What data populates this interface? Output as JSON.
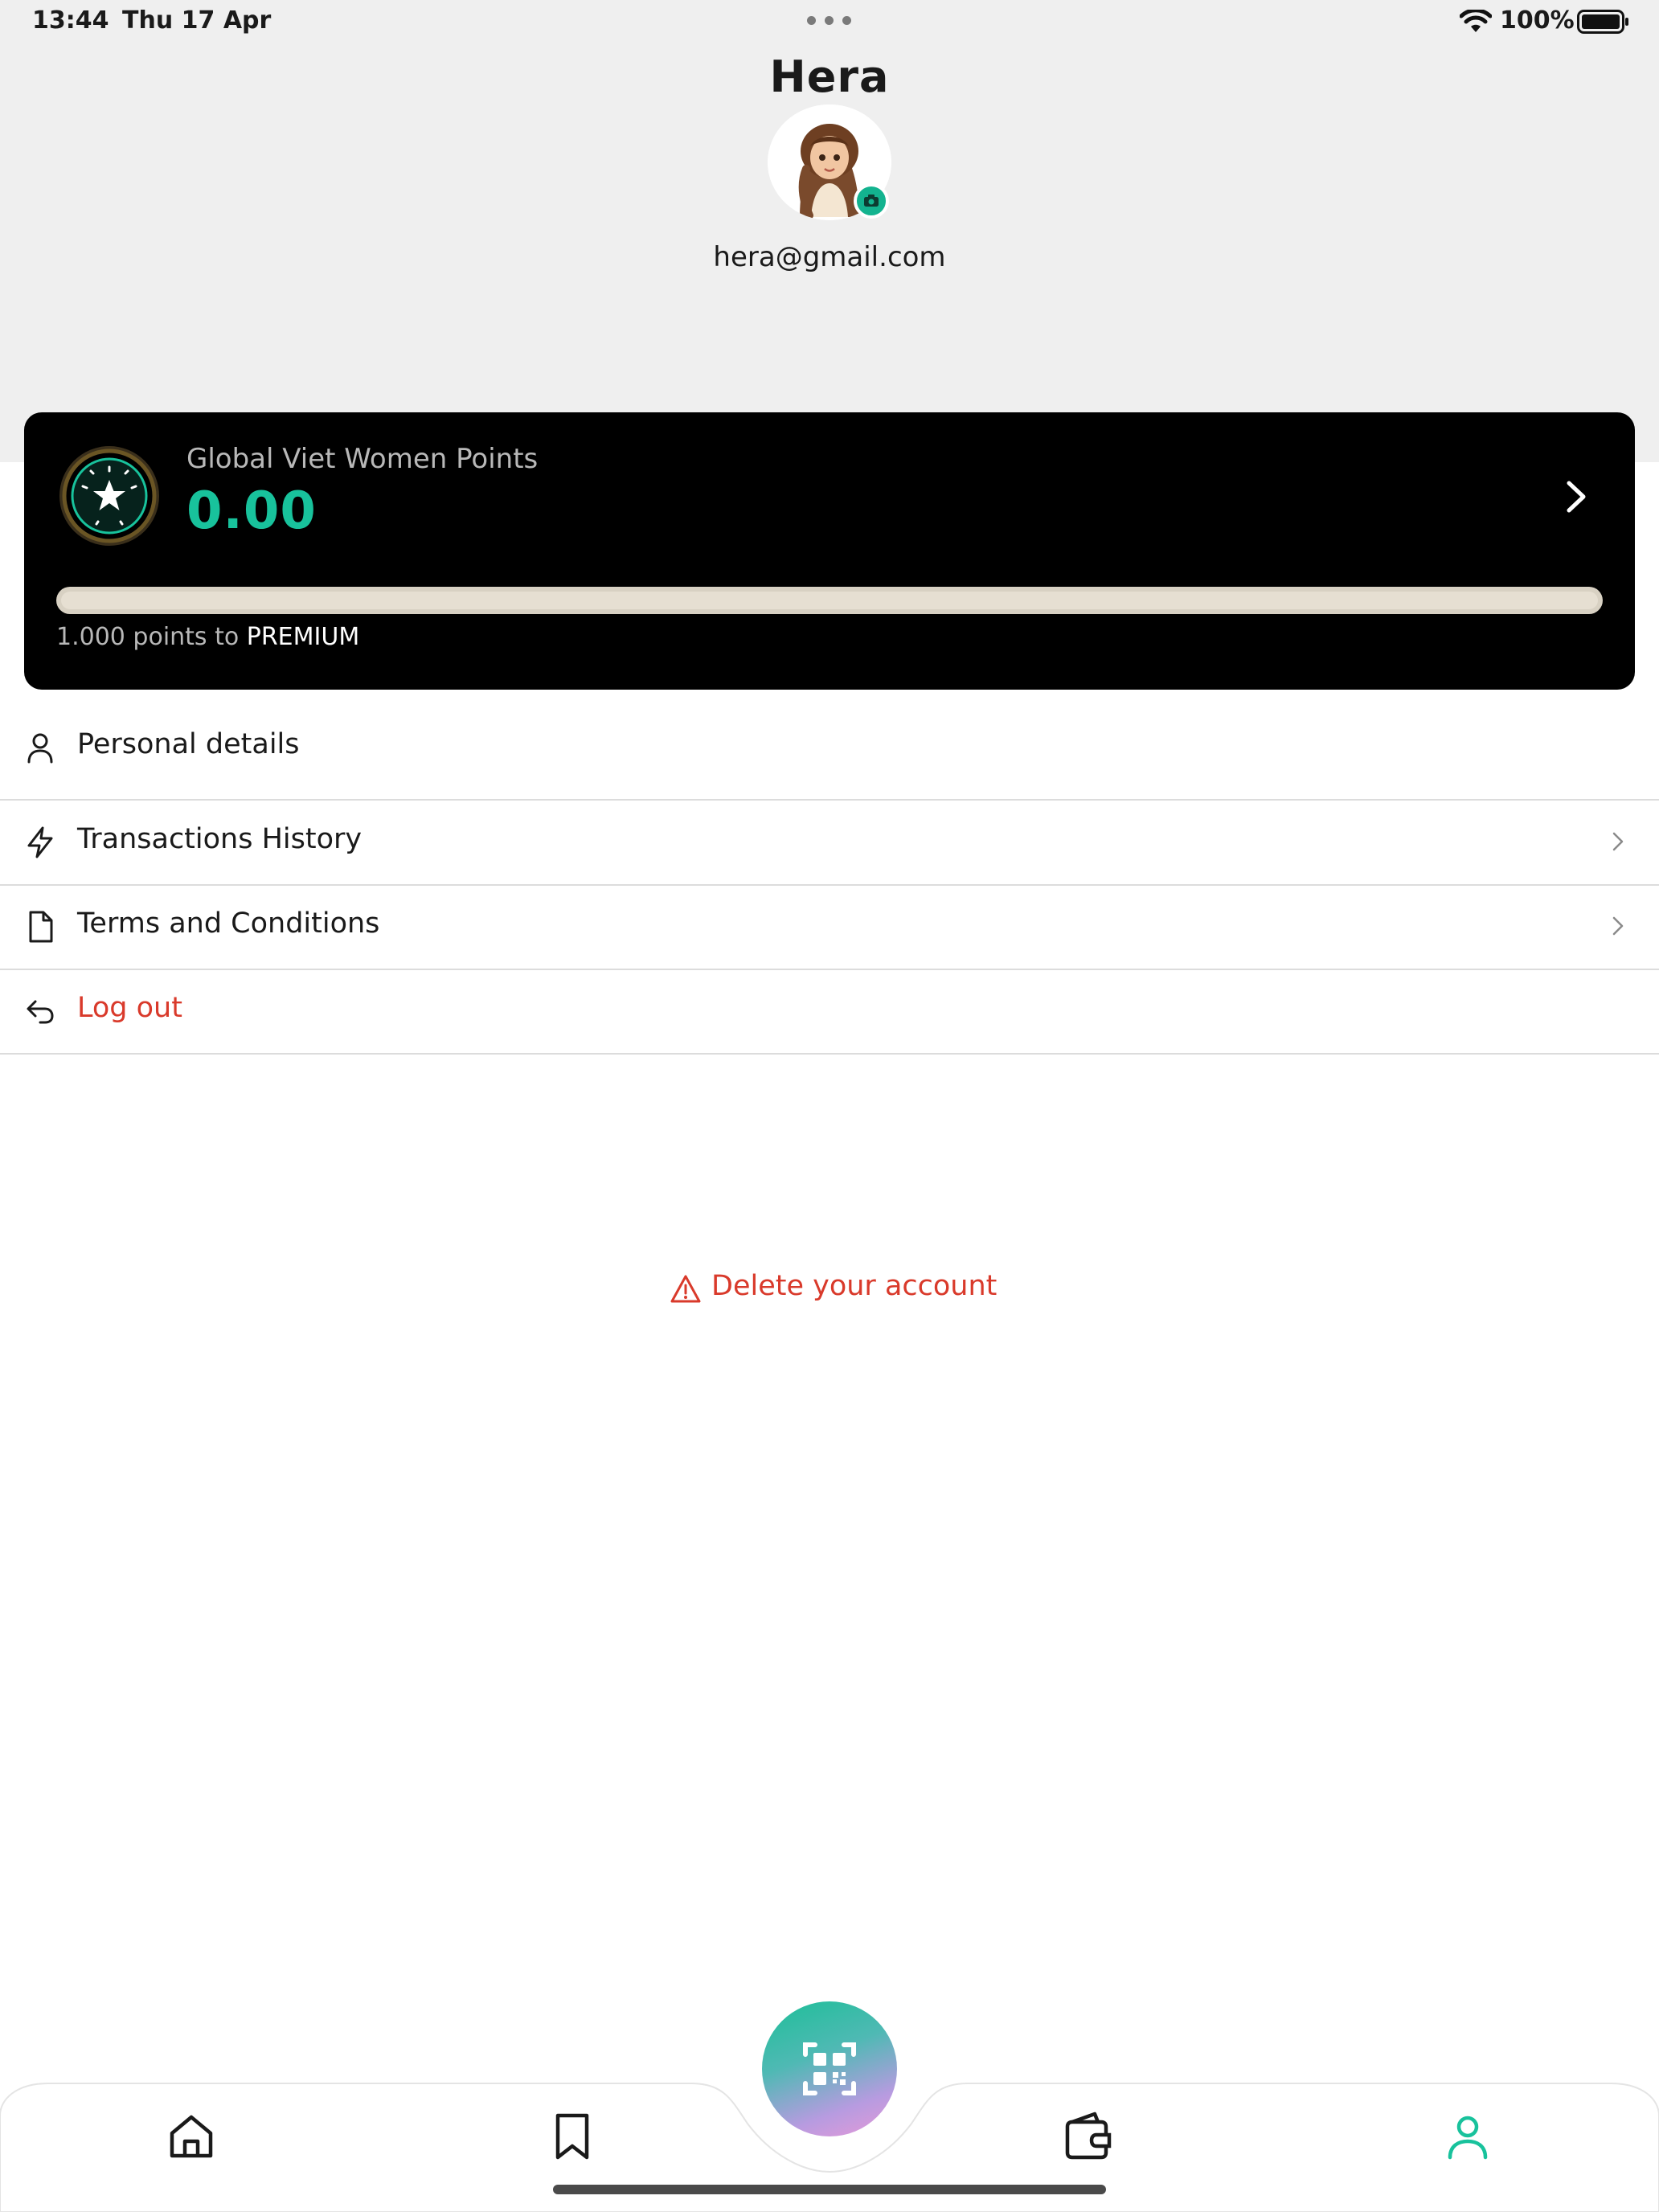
{
  "status_bar": {
    "time": "13:44",
    "date": "Thu 17 Apr",
    "battery": "100%"
  },
  "profile": {
    "name": "Hera",
    "email": "hera@gmail.com"
  },
  "points_card": {
    "label": "Global Viet Women Points",
    "value": "0.00",
    "progress_fraction": 0,
    "note_prefix": "1.000 points to ",
    "note_tier": "PREMIUM"
  },
  "menu": {
    "personal_details": "Personal details",
    "transactions_history": "Transactions History",
    "terms": "Terms and Conditions",
    "logout": "Log out"
  },
  "delete_account": "Delete your account",
  "colors": {
    "accent": "#18c29c",
    "danger": "#d93a2b",
    "card": "#000000",
    "header_bg": "#efefef"
  },
  "bottom_nav": {
    "tabs": [
      "home-icon",
      "bookmark-icon",
      "qr-scan-icon",
      "wallet-icon",
      "profile-icon"
    ],
    "active": "profile-icon"
  }
}
